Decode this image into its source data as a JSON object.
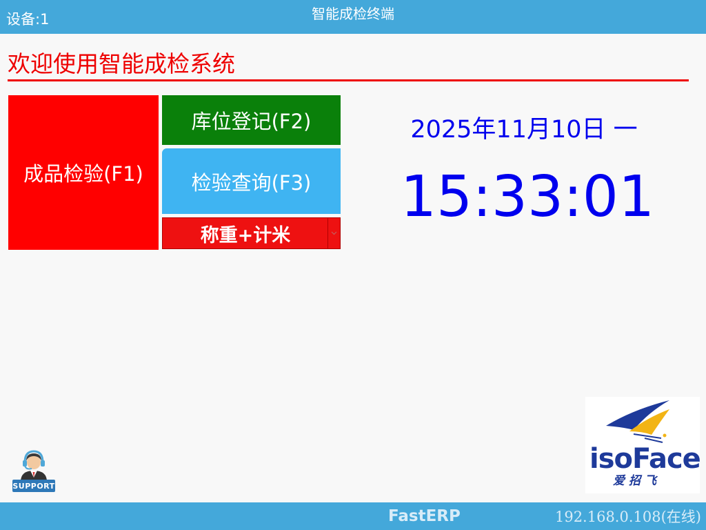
{
  "header": {
    "device_label": "设备:1",
    "title": "智能成检终端"
  },
  "welcome": {
    "text": "欢迎使用智能成检系统"
  },
  "buttons": {
    "f1_label": "成品检验(F1)",
    "f2_label": "库位登记(F2)",
    "f3_label": "检验查询(F3)"
  },
  "mode_select": {
    "selected": "称重+计米"
  },
  "clock": {
    "date": "2025年11月10日 一",
    "time": "15:33:01"
  },
  "support": {
    "label": "SUPPORT"
  },
  "logo": {
    "word": "isoFace",
    "cn": "爱招飞"
  },
  "footer": {
    "brand": "FastERP",
    "ip_status": "192.168.0.108(在线)"
  },
  "colors": {
    "header_bg": "#44a8da",
    "primary_red": "#ff0000",
    "green": "#0a800a",
    "light_blue": "#3fb4f2",
    "clock_blue": "#0000ee"
  }
}
